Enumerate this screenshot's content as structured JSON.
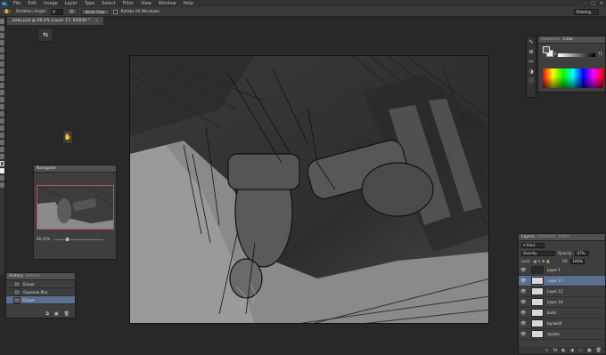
{
  "menubar": {
    "logo": "Ps",
    "items": [
      "File",
      "Edit",
      "Image",
      "Layer",
      "Type",
      "Select",
      "Filter",
      "View",
      "Window",
      "Help"
    ],
    "window_controls": [
      "–",
      "□",
      "✕"
    ]
  },
  "options": {
    "tool_glyph": "✋",
    "rotation_label": "Rotation Angle:",
    "rotation_value": "0°",
    "reset_label": "Reset View",
    "rotate_all_label": "Rotate All Windows",
    "workspace": "Painting"
  },
  "document": {
    "tab_title": "bako.psd @ 66.4% (Layer 17, RGB/8) *",
    "close_glyph": "×"
  },
  "navigator": {
    "tabs": [
      "Navigator"
    ],
    "zoom": "66.43%"
  },
  "history": {
    "tabs": [
      "History",
      "Actions"
    ],
    "items": [
      {
        "label": "Eraser",
        "active": false
      },
      {
        "label": "Gaussian Blur",
        "active": false
      },
      {
        "label": "Eraser",
        "active": true
      }
    ],
    "foot_icons": [
      "⧉",
      "▣",
      "🗑"
    ]
  },
  "color": {
    "tabs": [
      "Swatches",
      "Color"
    ],
    "k_label": "K",
    "k_value": "71",
    "k_percent": 71,
    "fg": "#555555",
    "bg": "#eeeeee"
  },
  "layers": {
    "tabs": [
      "Layers",
      "Channels",
      "Paths"
    ],
    "kind": "ℙ Kind",
    "blend_mode": "Overlay",
    "opacity_label": "Opacity:",
    "opacity": "67%",
    "lock_label": "Lock:",
    "fill_label": "Fill:",
    "fill": "100%",
    "rows": [
      {
        "name": "Layer 1",
        "active": false,
        "dark": true
      },
      {
        "name": "Layer 17",
        "active": true,
        "dark": false
      },
      {
        "name": "Layer 12",
        "active": false,
        "dark": false
      },
      {
        "name": "Layer 10",
        "active": false,
        "dark": false
      },
      {
        "name": "build",
        "active": false,
        "dark": false
      },
      {
        "name": "bg build",
        "active": false,
        "dark": false
      },
      {
        "name": "skyline",
        "active": false,
        "dark": false
      }
    ],
    "foot_icons": [
      "∞",
      "fx",
      "◐",
      "◑",
      "▭",
      "▣",
      "🗑"
    ]
  }
}
